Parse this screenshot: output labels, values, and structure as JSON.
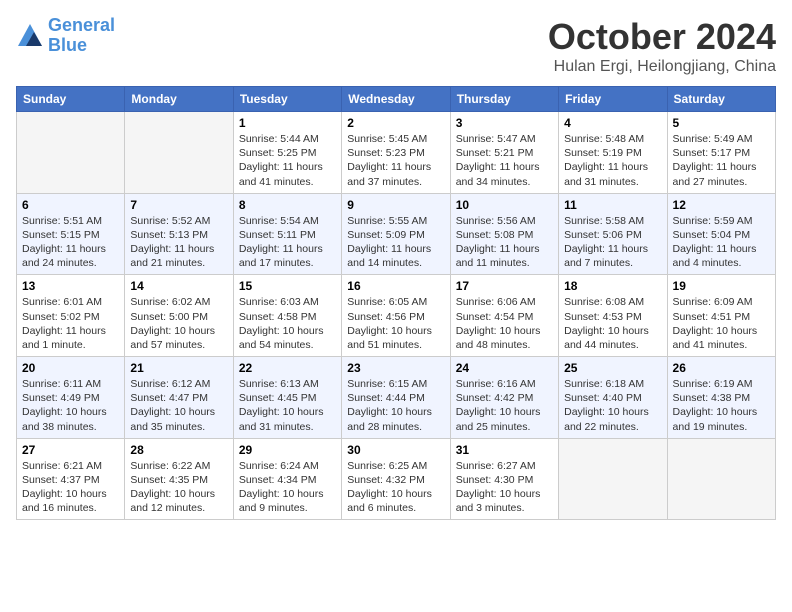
{
  "header": {
    "logo_line1": "General",
    "logo_line2": "Blue",
    "month": "October 2024",
    "location": "Hulan Ergi, Heilongjiang, China"
  },
  "days_of_week": [
    "Sunday",
    "Monday",
    "Tuesday",
    "Wednesday",
    "Thursday",
    "Friday",
    "Saturday"
  ],
  "weeks": [
    [
      {
        "day": "",
        "empty": true
      },
      {
        "day": "",
        "empty": true
      },
      {
        "day": "1",
        "sunrise": "5:44 AM",
        "sunset": "5:25 PM",
        "daylight": "11 hours and 41 minutes."
      },
      {
        "day": "2",
        "sunrise": "5:45 AM",
        "sunset": "5:23 PM",
        "daylight": "11 hours and 37 minutes."
      },
      {
        "day": "3",
        "sunrise": "5:47 AM",
        "sunset": "5:21 PM",
        "daylight": "11 hours and 34 minutes."
      },
      {
        "day": "4",
        "sunrise": "5:48 AM",
        "sunset": "5:19 PM",
        "daylight": "11 hours and 31 minutes."
      },
      {
        "day": "5",
        "sunrise": "5:49 AM",
        "sunset": "5:17 PM",
        "daylight": "11 hours and 27 minutes."
      }
    ],
    [
      {
        "day": "6",
        "sunrise": "5:51 AM",
        "sunset": "5:15 PM",
        "daylight": "11 hours and 24 minutes."
      },
      {
        "day": "7",
        "sunrise": "5:52 AM",
        "sunset": "5:13 PM",
        "daylight": "11 hours and 21 minutes."
      },
      {
        "day": "8",
        "sunrise": "5:54 AM",
        "sunset": "5:11 PM",
        "daylight": "11 hours and 17 minutes."
      },
      {
        "day": "9",
        "sunrise": "5:55 AM",
        "sunset": "5:09 PM",
        "daylight": "11 hours and 14 minutes."
      },
      {
        "day": "10",
        "sunrise": "5:56 AM",
        "sunset": "5:08 PM",
        "daylight": "11 hours and 11 minutes."
      },
      {
        "day": "11",
        "sunrise": "5:58 AM",
        "sunset": "5:06 PM",
        "daylight": "11 hours and 7 minutes."
      },
      {
        "day": "12",
        "sunrise": "5:59 AM",
        "sunset": "5:04 PM",
        "daylight": "11 hours and 4 minutes."
      }
    ],
    [
      {
        "day": "13",
        "sunrise": "6:01 AM",
        "sunset": "5:02 PM",
        "daylight": "11 hours and 1 minute."
      },
      {
        "day": "14",
        "sunrise": "6:02 AM",
        "sunset": "5:00 PM",
        "daylight": "10 hours and 57 minutes."
      },
      {
        "day": "15",
        "sunrise": "6:03 AM",
        "sunset": "4:58 PM",
        "daylight": "10 hours and 54 minutes."
      },
      {
        "day": "16",
        "sunrise": "6:05 AM",
        "sunset": "4:56 PM",
        "daylight": "10 hours and 51 minutes."
      },
      {
        "day": "17",
        "sunrise": "6:06 AM",
        "sunset": "4:54 PM",
        "daylight": "10 hours and 48 minutes."
      },
      {
        "day": "18",
        "sunrise": "6:08 AM",
        "sunset": "4:53 PM",
        "daylight": "10 hours and 44 minutes."
      },
      {
        "day": "19",
        "sunrise": "6:09 AM",
        "sunset": "4:51 PM",
        "daylight": "10 hours and 41 minutes."
      }
    ],
    [
      {
        "day": "20",
        "sunrise": "6:11 AM",
        "sunset": "4:49 PM",
        "daylight": "10 hours and 38 minutes."
      },
      {
        "day": "21",
        "sunrise": "6:12 AM",
        "sunset": "4:47 PM",
        "daylight": "10 hours and 35 minutes."
      },
      {
        "day": "22",
        "sunrise": "6:13 AM",
        "sunset": "4:45 PM",
        "daylight": "10 hours and 31 minutes."
      },
      {
        "day": "23",
        "sunrise": "6:15 AM",
        "sunset": "4:44 PM",
        "daylight": "10 hours and 28 minutes."
      },
      {
        "day": "24",
        "sunrise": "6:16 AM",
        "sunset": "4:42 PM",
        "daylight": "10 hours and 25 minutes."
      },
      {
        "day": "25",
        "sunrise": "6:18 AM",
        "sunset": "4:40 PM",
        "daylight": "10 hours and 22 minutes."
      },
      {
        "day": "26",
        "sunrise": "6:19 AM",
        "sunset": "4:38 PM",
        "daylight": "10 hours and 19 minutes."
      }
    ],
    [
      {
        "day": "27",
        "sunrise": "6:21 AM",
        "sunset": "4:37 PM",
        "daylight": "10 hours and 16 minutes."
      },
      {
        "day": "28",
        "sunrise": "6:22 AM",
        "sunset": "4:35 PM",
        "daylight": "10 hours and 12 minutes."
      },
      {
        "day": "29",
        "sunrise": "6:24 AM",
        "sunset": "4:34 PM",
        "daylight": "10 hours and 9 minutes."
      },
      {
        "day": "30",
        "sunrise": "6:25 AM",
        "sunset": "4:32 PM",
        "daylight": "10 hours and 6 minutes."
      },
      {
        "day": "31",
        "sunrise": "6:27 AM",
        "sunset": "4:30 PM",
        "daylight": "10 hours and 3 minutes."
      },
      {
        "day": "",
        "empty": true
      },
      {
        "day": "",
        "empty": true
      }
    ]
  ]
}
